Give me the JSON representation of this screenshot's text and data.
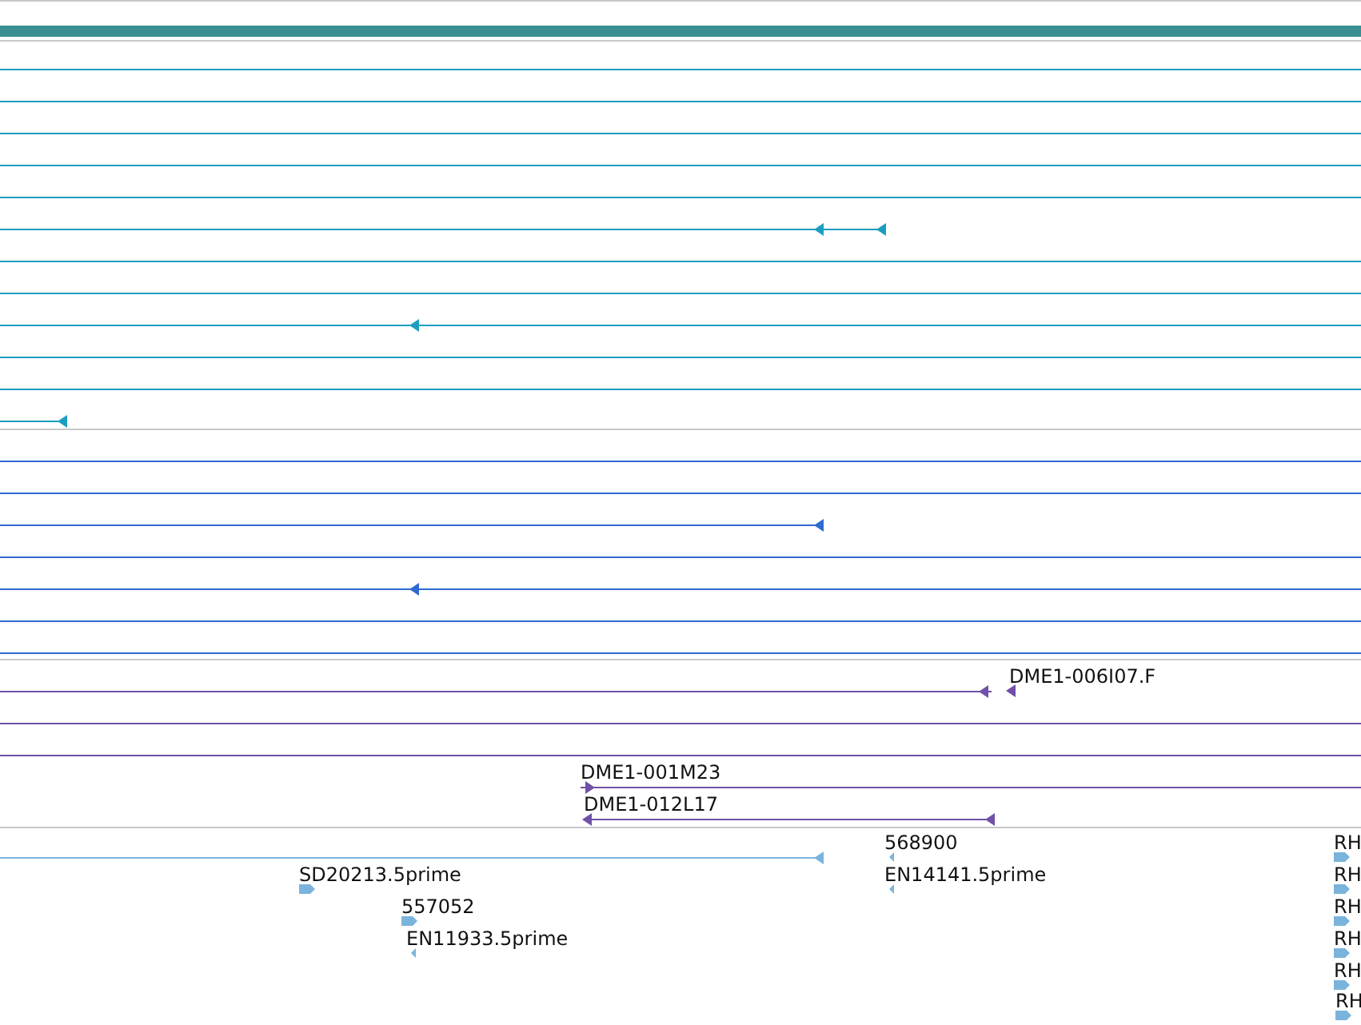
{
  "tracks": [
    {
      "color": "#1a9ec0"
    },
    {
      "color": "#2e6ad0"
    },
    {
      "color": "#7050a8",
      "features": [
        {
          "label": "DME1-006I07.F",
          "kind": "reverse"
        },
        {
          "label": "DME1-001M23",
          "kind": "forward"
        },
        {
          "label": "DME1-012L17",
          "kind": "reverse"
        }
      ]
    },
    {
      "color": "#7ab4dc",
      "features": [
        {
          "label": "568900",
          "kind": "reverse"
        },
        {
          "label": "RH",
          "kind": "forward"
        },
        {
          "label": "SD20213.5prime",
          "kind": "forward"
        },
        {
          "label": "EN14141.5prime",
          "kind": "reverse"
        },
        {
          "label": "RH",
          "kind": "forward"
        },
        {
          "label": "557052",
          "kind": "forward"
        },
        {
          "label": "RH",
          "kind": "forward"
        },
        {
          "label": "EN11933.5prime",
          "kind": "reverse"
        },
        {
          "label": "RH",
          "kind": "forward"
        },
        {
          "label": "RH",
          "kind": "forward"
        },
        {
          "label": "RH",
          "kind": "forward"
        }
      ]
    }
  ]
}
